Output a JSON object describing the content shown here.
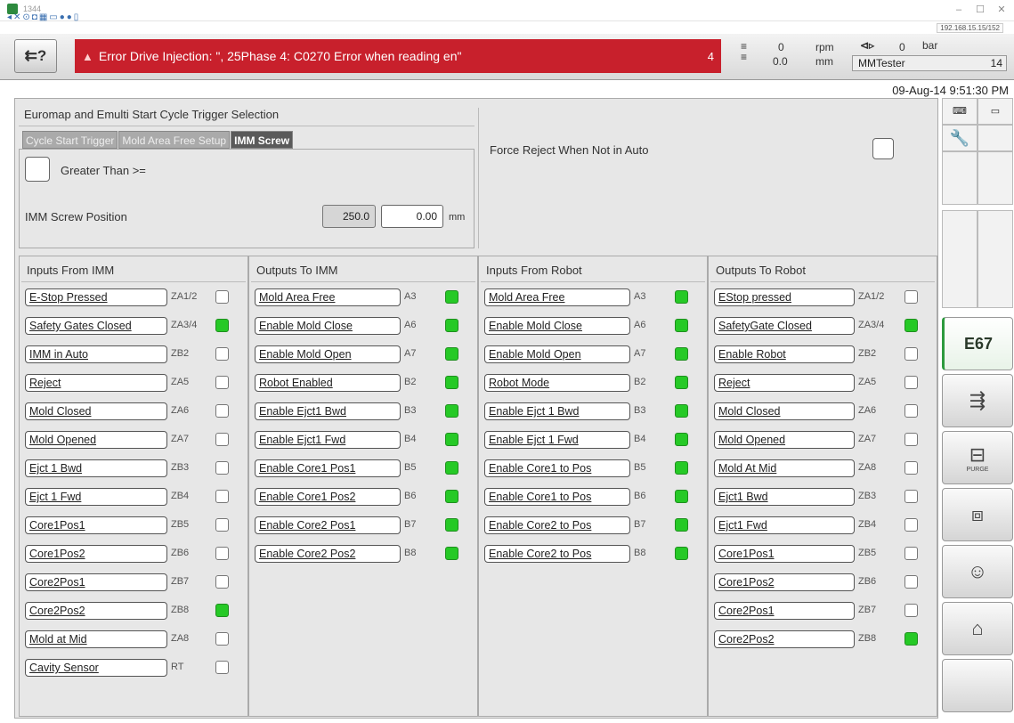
{
  "window": {
    "title": "1344",
    "address": "192.168.15.15/152"
  },
  "header": {
    "login_icon": "login-help-icon",
    "alarm_text": "Error Drive Injection: \", 25Phase 4: C0270 Error when reading en\"",
    "alarm_count": "4",
    "screw_value": "0",
    "screw_pos": "0.0",
    "rpm_unit": "rpm",
    "mm_unit": "mm",
    "pressure_value": "0",
    "bar_unit": "bar",
    "user": "MMTester",
    "page_num": "14",
    "datetime": "09-Aug-14 9:51:30 PM"
  },
  "panel": {
    "title": "Euromap and Emulti Start Cycle Trigger Selection",
    "tabs": [
      "Cycle Start Trigger",
      "Mold Area Free Setup",
      "IMM Screw"
    ],
    "greater_than": "Greater Than >=",
    "screw_position_label": "IMM Screw Position",
    "screw_actual": "250.0",
    "screw_setpoint": "0.00",
    "screw_unit": "mm",
    "force_reject": "Force Reject When Not in Auto"
  },
  "columns": [
    {
      "title": "Inputs From IMM",
      "rows": [
        {
          "label": "E-Stop Pressed",
          "code": "ZA1/2",
          "on": false
        },
        {
          "label": "Safety Gates Closed",
          "code": "ZA3/4",
          "on": true
        },
        {
          "label": "IMM in Auto",
          "code": "ZB2",
          "on": false
        },
        {
          "label": "Reject",
          "code": "ZA5",
          "on": false
        },
        {
          "label": "Mold Closed",
          "code": "ZA6",
          "on": false
        },
        {
          "label": "Mold Opened",
          "code": "ZA7",
          "on": false
        },
        {
          "label": "Ejct 1 Bwd",
          "code": "ZB3",
          "on": false
        },
        {
          "label": "Ejct 1 Fwd",
          "code": "ZB4",
          "on": false
        },
        {
          "label": "Core1Pos1",
          "code": "ZB5",
          "on": false
        },
        {
          "label": "Core1Pos2",
          "code": "ZB6",
          "on": false
        },
        {
          "label": "Core2Pos1",
          "code": "ZB7",
          "on": false
        },
        {
          "label": "Core2Pos2",
          "code": "ZB8",
          "on": true
        },
        {
          "label": "Mold at Mid",
          "code": "ZA8",
          "on": false
        },
        {
          "label": "Cavity Sensor",
          "code": "RT",
          "on": false
        }
      ]
    },
    {
      "title": "Outputs To IMM",
      "rows": [
        {
          "label": "Mold Area Free",
          "code": "A3",
          "on": true
        },
        {
          "label": "Enable Mold Close",
          "code": "A6",
          "on": true
        },
        {
          "label": "Enable Mold Open",
          "code": "A7",
          "on": true
        },
        {
          "label": "Robot Enabled",
          "code": "B2",
          "on": true
        },
        {
          "label": "Enable Ejct1 Bwd",
          "code": "B3",
          "on": true
        },
        {
          "label": "Enable Ejct1 Fwd",
          "code": "B4",
          "on": true
        },
        {
          "label": "Enable Core1 Pos1",
          "code": "B5",
          "on": true
        },
        {
          "label": "Enable Core1 Pos2",
          "code": "B6",
          "on": true
        },
        {
          "label": "Enable Core2 Pos1",
          "code": "B7",
          "on": true
        },
        {
          "label": "Enable Core2 Pos2",
          "code": "B8",
          "on": true
        }
      ]
    },
    {
      "title": "Inputs From Robot",
      "rows": [
        {
          "label": "Mold Area Free",
          "code": "A3",
          "on": true
        },
        {
          "label": "Enable Mold Close",
          "code": "A6",
          "on": true
        },
        {
          "label": "Enable Mold Open",
          "code": "A7",
          "on": true
        },
        {
          "label": "Robot Mode",
          "code": "B2",
          "on": true
        },
        {
          "label": "Enable Ejct 1 Bwd",
          "code": "B3",
          "on": true
        },
        {
          "label": "Enable Ejct 1 Fwd",
          "code": "B4",
          "on": true
        },
        {
          "label": "Enable Core1 to Pos",
          "code": "B5",
          "on": true
        },
        {
          "label": "Enable Core1 to Pos",
          "code": "B6",
          "on": true
        },
        {
          "label": "Enable Core2 to Pos",
          "code": "B7",
          "on": true
        },
        {
          "label": "Enable Core2 to Pos",
          "code": "B8",
          "on": true
        }
      ]
    },
    {
      "title": "Outputs To Robot",
      "rows": [
        {
          "label": "EStop pressed",
          "code": "ZA1/2",
          "on": false
        },
        {
          "label": "SafetyGate Closed",
          "code": "ZA3/4",
          "on": true
        },
        {
          "label": "Enable Robot",
          "code": "ZB2",
          "on": false
        },
        {
          "label": "Reject",
          "code": "ZA5",
          "on": false
        },
        {
          "label": "Mold Closed",
          "code": "ZA6",
          "on": false
        },
        {
          "label": "Mold Opened",
          "code": "ZA7",
          "on": false
        },
        {
          "label": "Mold At Mid",
          "code": "ZA8",
          "on": false
        },
        {
          "label": "Ejct1 Bwd",
          "code": "ZB3",
          "on": false
        },
        {
          "label": "Ejct1 Fwd",
          "code": "ZB4",
          "on": false
        },
        {
          "label": "Core1Pos1",
          "code": "ZB5",
          "on": false
        },
        {
          "label": "Core1Pos2",
          "code": "ZB6",
          "on": false
        },
        {
          "label": "Core2Pos1",
          "code": "ZB7",
          "on": false
        },
        {
          "label": "Core2Pos2",
          "code": "ZB8",
          "on": true
        }
      ]
    }
  ],
  "sidebar": {
    "e67_label": "E67",
    "purge_label": "PURGE",
    "icons": [
      "keyboard-icon",
      "wrench-icon",
      "injection-icon",
      "purge-icon",
      "window-icon",
      "operator-icon",
      "production-icon"
    ]
  },
  "colors": {
    "alarm": "#c8202c",
    "led_on": "#26c926",
    "accent": "#2d9a3e"
  }
}
